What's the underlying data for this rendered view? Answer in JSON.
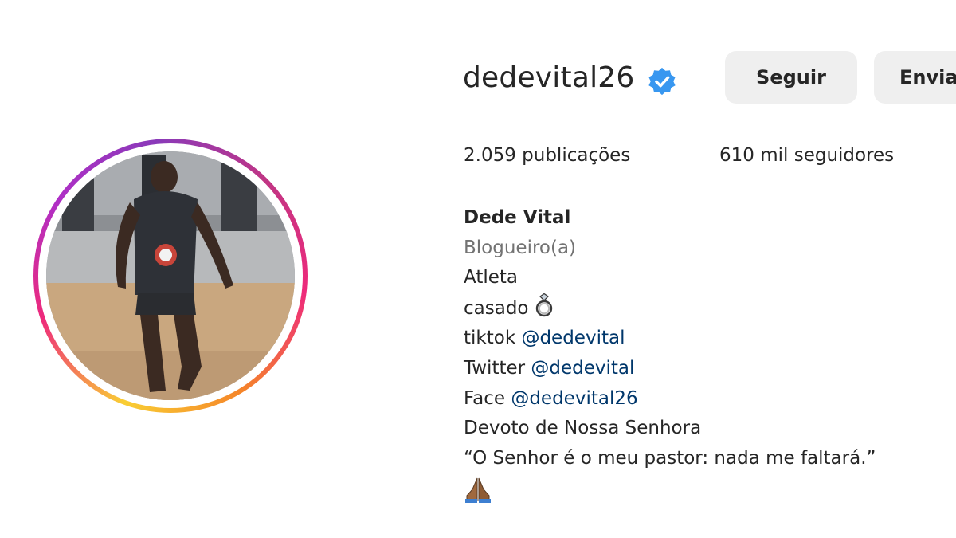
{
  "profile": {
    "username": "dedevital26",
    "verified_icon": "verified-badge-icon",
    "follow_label": "Seguir",
    "message_label": "Enviar",
    "stats": {
      "posts": "2.059 publicações",
      "followers": "610 mil seguidores"
    },
    "bio": {
      "name": "Dede Vital",
      "category": "Blogueiro(a)",
      "line_athlete": "Atleta",
      "line_married": "casado",
      "married_emoji_icon": "ring-icon",
      "tiktok_label": "tiktok",
      "tiktok_handle": "@dedevital",
      "twitter_label": "Twitter",
      "twitter_handle": "@dedevital",
      "face_label": "Face",
      "face_handle": "@dedevital26",
      "line_devotion": "Devoto de Nossa Senhora",
      "line_quote": "“O Senhor é o meu pastor: nada me faltará.”",
      "pray_emoji_icon": "praying-hands-icon"
    }
  },
  "colors": {
    "text": "#262626",
    "secondary_text": "#737373",
    "link": "#00376b",
    "button_bg": "#efefef",
    "verified_blue": "#3897f0"
  }
}
